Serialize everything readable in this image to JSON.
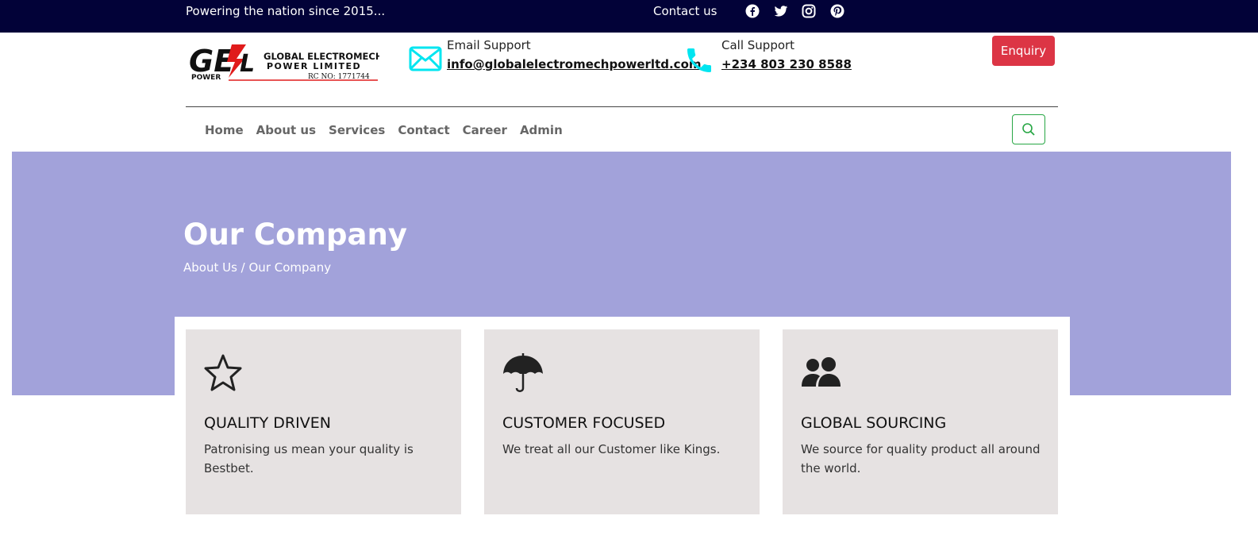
{
  "topbar": {
    "tagline": "Powering the nation since 2015...",
    "contact": "Contact us",
    "social": [
      "facebook-icon",
      "twitter-icon",
      "instagram-icon",
      "pinterest-icon"
    ]
  },
  "logo": {
    "mark": "GEL",
    "line1": "GLOBAL ELECTROMECH",
    "line2": "POWER LIMITED",
    "sub": "POWER",
    "rc": "RC NO: 1771744"
  },
  "email": {
    "label": "Email Support",
    "value": "info@globalelectromechpowerltd.com",
    "icon": "envelope-icon"
  },
  "phone": {
    "label": "Call Support",
    "value": "+234 803 230 8588",
    "icon": "phone-icon"
  },
  "enquiry": "Enquiry",
  "nav": [
    "Home",
    "About us",
    "Services",
    "Contact",
    "Career",
    "Admin"
  ],
  "hero": {
    "title": "Our Company",
    "breadcrumb": "About Us / Our Company"
  },
  "cards": [
    {
      "icon": "star-icon",
      "title": "QUALITY DRIVEN",
      "text": "Patronising us mean your quality is Bestbet."
    },
    {
      "icon": "umbrella-icon",
      "title": "CUSTOMER FOCUSED",
      "text": "We treat all our Customer like Kings."
    },
    {
      "icon": "people-icon",
      "title": "GLOBAL SOURCING",
      "text": "We source for quality product all around the world."
    }
  ],
  "colors": {
    "topbar": "#020238",
    "hero": "#a2a2da",
    "card": "#e6e2e2",
    "accent_cyan": "#00e5f0",
    "enquiry": "#dc3545",
    "search_border": "#28a745"
  }
}
